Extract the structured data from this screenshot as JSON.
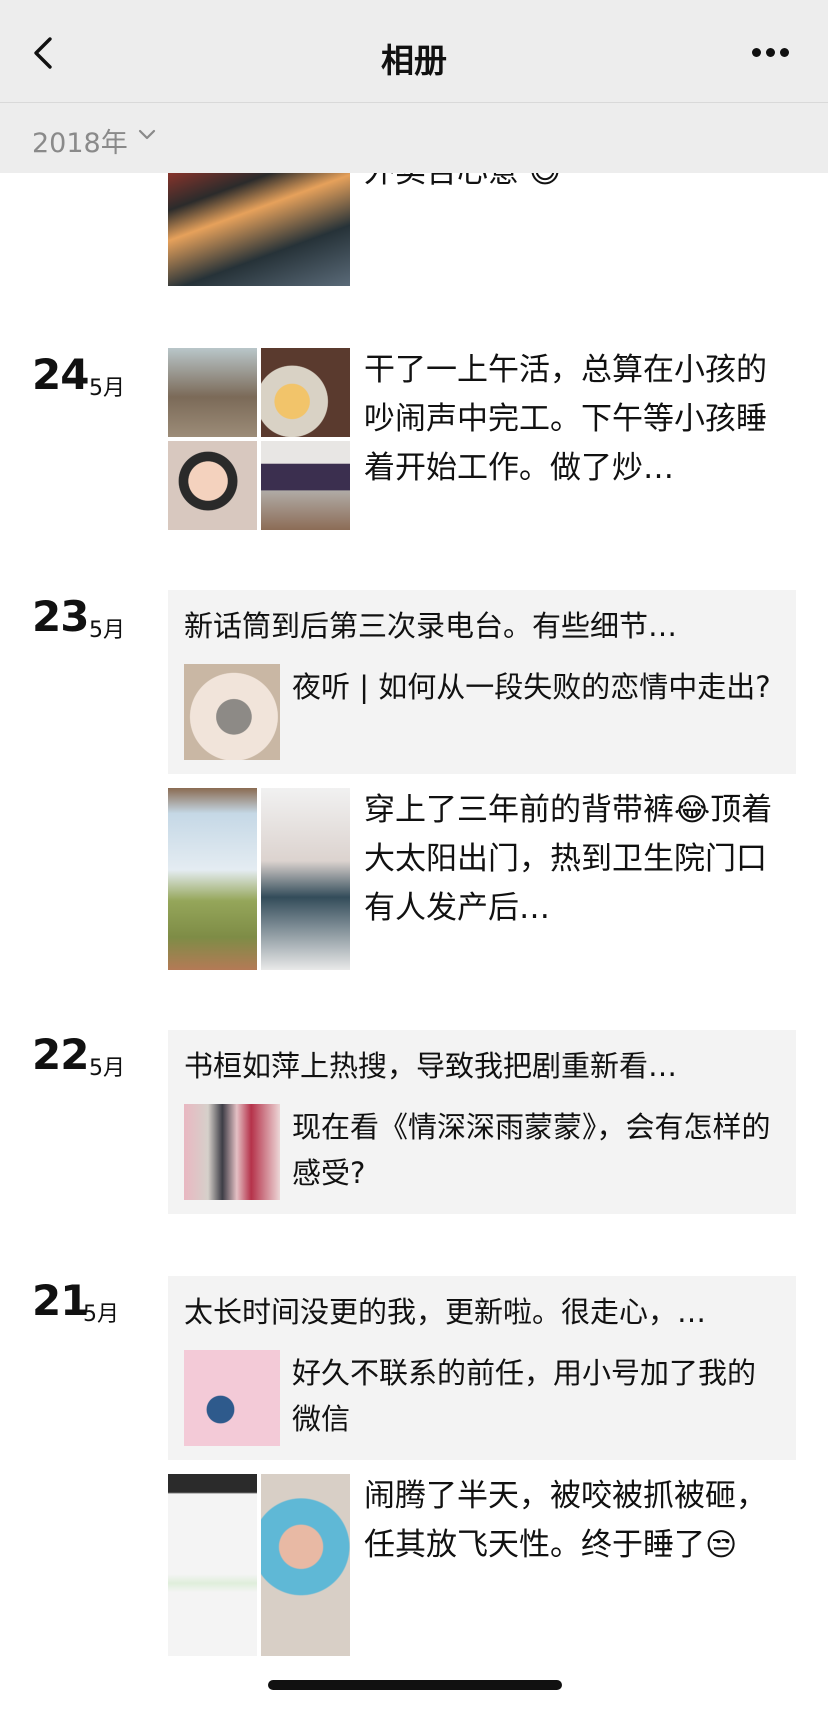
{
  "header": {
    "title": "相册",
    "back_icon": "chevron-left-icon",
    "more_icon": "more-dots-icon"
  },
  "filter": {
    "year": "2018年",
    "chevron_icon": "chevron-down-icon"
  },
  "partial_top": {
    "text": "外卖吉心意 😅"
  },
  "days": [
    {
      "day": "24",
      "month": "5月",
      "post": {
        "text": "干了一上午活，总算在小孩的吵闹声中完工。下午等小孩睡着开始工作。做了炒…"
      }
    },
    {
      "day": "23",
      "month": "5月",
      "share": {
        "caption": "新话筒到后第三次录电台。有些细节…",
        "title": "夜听 | 如何从一段失败的恋情中走出?"
      },
      "post": {
        "text": "穿上了三年前的背带裤😂顶着大太阳出门，热到卫生院门口有人发产后…"
      }
    },
    {
      "day": "22",
      "month": "5月",
      "share": {
        "caption": "书桓如萍上热搜，导致我把剧重新看…",
        "title": "现在看《情深深雨蒙蒙》，会有怎样的感受?"
      }
    },
    {
      "day": "21",
      "month": "5月",
      "share": {
        "caption": "太长时间没更的我，更新啦。很走心，…",
        "title": "好久不联系的前任，用小号加了我的微信"
      },
      "post": {
        "text": "闹腾了半天，被咬被抓被砸，任其放飞天性。终于睡了😒"
      }
    }
  ]
}
